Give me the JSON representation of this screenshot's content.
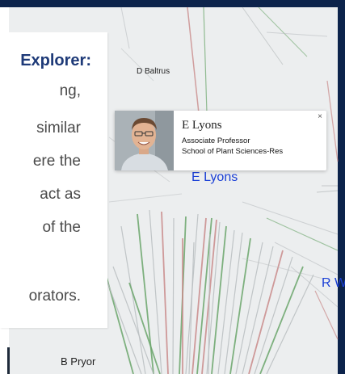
{
  "panel": {
    "title": "Explorer:",
    "lines": [
      "ng,",
      "similar",
      "ere the",
      "act as",
      "of the",
      "",
      "orators."
    ]
  },
  "nodes": {
    "d_baltrus": "D Baltrus",
    "e_lyons": "E Lyons",
    "r_w": "R W",
    "b_pryor": "B Pryor"
  },
  "tooltip": {
    "close": "×",
    "name": "E Lyons",
    "title": "Associate Professor",
    "department": "School of Plant Sciences-Res",
    "avatar_icon": "person-photo"
  },
  "colors": {
    "frame": "#0c234b",
    "panel_title": "#1e3a78",
    "focus_label": "#1a3fd6",
    "edge_gray": "#b9bdbf",
    "edge_green": "#6aa56a",
    "edge_red": "#c98a8a"
  }
}
